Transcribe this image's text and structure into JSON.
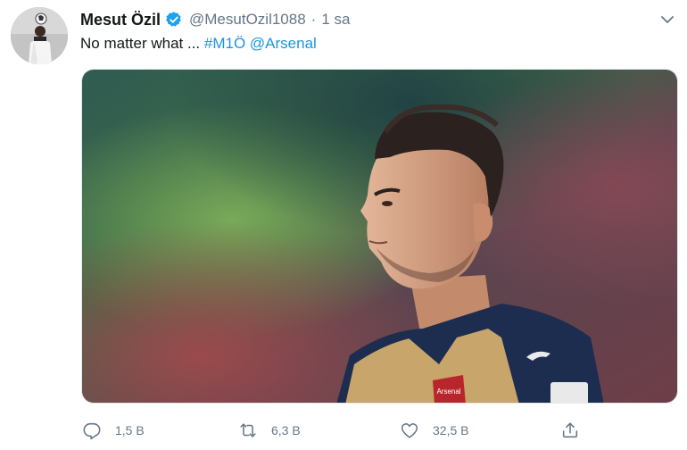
{
  "tweet": {
    "author_name": "Mesut Özil",
    "handle": "@MesutOzil1088",
    "separator": "·",
    "timestamp": "1 sa",
    "text_plain": "No matter what ... ",
    "hashtag": "#M1Ö",
    "mention": "@Arsenal",
    "verified": true,
    "media": {
      "type": "photo",
      "shirt_text": "Arsenal"
    },
    "actions": {
      "reply_count": "1,5 B",
      "retweet_count": "6,3 B",
      "like_count": "32,5 B"
    }
  },
  "icons": {
    "verified": "verified-badge-icon",
    "caret": "chevron-down-icon",
    "reply": "reply-icon",
    "retweet": "retweet-icon",
    "like": "heart-icon",
    "share": "share-icon"
  },
  "colors": {
    "link": "#1b95e0",
    "verified": "#1da1f2",
    "muted": "#657786"
  }
}
